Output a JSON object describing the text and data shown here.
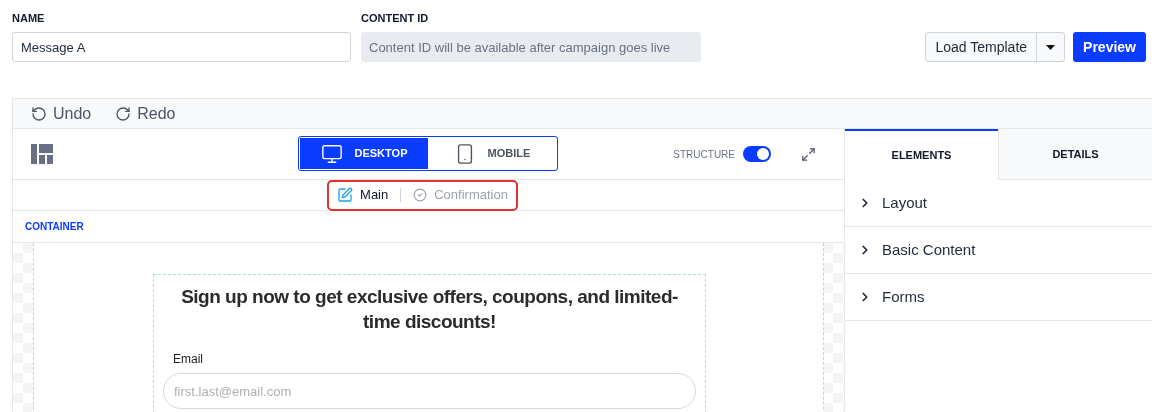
{
  "name_field": {
    "label": "NAME",
    "value": "Message A"
  },
  "content_id_field": {
    "label": "CONTENT ID",
    "placeholder": "Content ID will be available after campaign goes live"
  },
  "load_template_button": {
    "label": "Load Template"
  },
  "preview_button": {
    "label": "Preview"
  },
  "toolbar": [
    {
      "kind": "undo",
      "label": "Undo"
    },
    {
      "kind": "redo",
      "label": "Redo"
    }
  ],
  "device_toggle": [
    {
      "kind": "desktop",
      "label": "DESKTOP",
      "selected": true
    },
    {
      "kind": "mobile",
      "label": "MOBILE",
      "selected": false
    }
  ],
  "structure_toggle": {
    "label": "STRUCTURE",
    "on": true
  },
  "message_tabs": [
    {
      "kind": "main",
      "label": "Main",
      "selected": true
    },
    {
      "kind": "confirmation",
      "label": "Confirmation",
      "selected": false
    }
  ],
  "container_label": "CONTAINER",
  "form": {
    "heading": "Sign up now to get exclusive offers, coupons, and limited-time discounts!",
    "email_label": "Email",
    "email_placeholder": "first.last@email.com"
  },
  "panel_tabs": [
    {
      "label": "ELEMENTS",
      "selected": true
    },
    {
      "label": "DETAILS",
      "selected": false
    }
  ],
  "sections": [
    {
      "label": "Layout",
      "expanded": false
    },
    {
      "label": "Basic Content",
      "expanded": false
    },
    {
      "label": "Forms",
      "expanded": false
    }
  ]
}
